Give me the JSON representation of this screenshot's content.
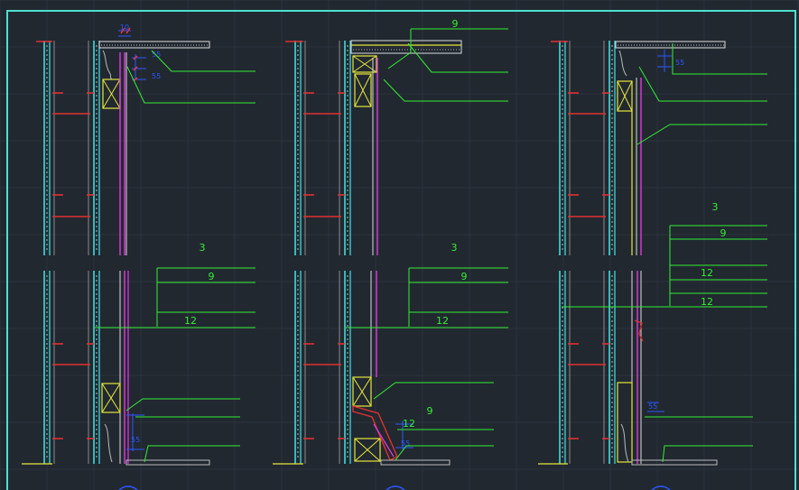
{
  "colors": {
    "background": "#212830",
    "grid": "#2a323c",
    "frame": "#4fe0d0",
    "wall": "#3fe7e7",
    "column": "#e03030",
    "leader": "#33ee33",
    "dimension": "#2b57ff",
    "dim_tick": "#ff3030",
    "finish": "#e03adf",
    "timber": "#e6e63a",
    "hatch": "#c8c8c8",
    "base_line": "#e6e63a"
  },
  "panels": [
    {
      "id": "A",
      "labels": [],
      "dims": [
        "10",
        "55",
        "55"
      ]
    },
    {
      "id": "B",
      "labels": [
        "9"
      ],
      "dims": []
    },
    {
      "id": "C",
      "labels": [],
      "dims": [
        "55"
      ]
    },
    {
      "id": "D",
      "labels": [
        "3",
        "9",
        "12"
      ],
      "dims": [
        "55"
      ]
    },
    {
      "id": "E",
      "labels": [
        "3",
        "9",
        "12",
        "9",
        "12"
      ],
      "dims": [
        "55"
      ]
    },
    {
      "id": "F",
      "labels": [
        "3",
        "9",
        "12",
        "12"
      ],
      "dims": [
        "55"
      ]
    }
  ]
}
